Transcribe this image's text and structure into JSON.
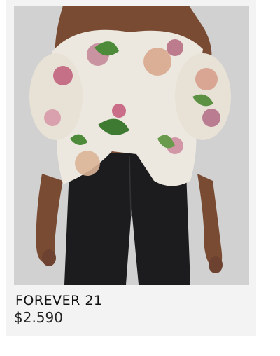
{
  "product": {
    "image_alt": "Off-shoulder floral print top with black jeans",
    "brand": "FOREVER 21",
    "price": "$2.590"
  },
  "colors": {
    "card_background": "#f3f3f3",
    "photo_background": "#cfcfcf",
    "text_primary": "#111111"
  }
}
